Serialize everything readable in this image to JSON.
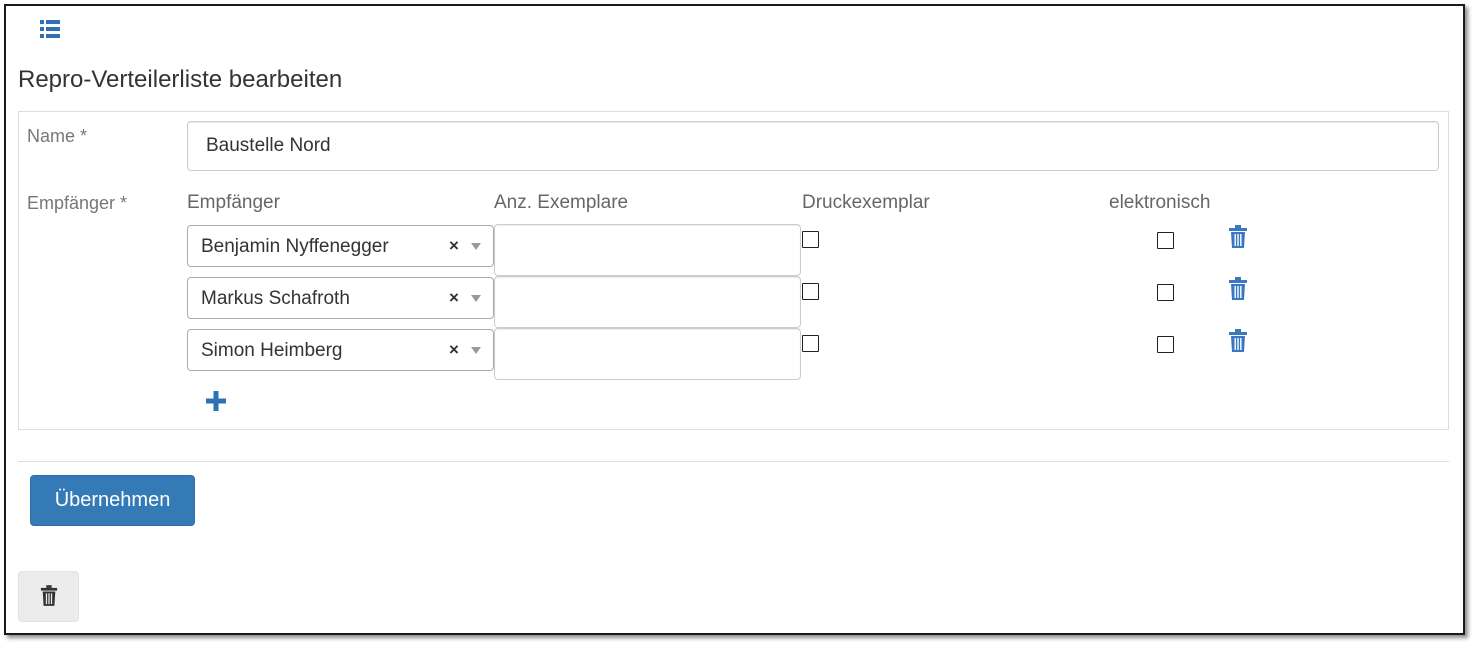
{
  "header": {
    "list_icon": "list-icon",
    "title": "Repro-Verteilerliste bearbeiten"
  },
  "form": {
    "name_label": "Name *",
    "name_value": "Baustelle Nord",
    "recipients_label": "Empfänger *",
    "columns": {
      "recipient": "Empfänger",
      "copies": "Anz. Exemplare",
      "print_copy": "Druckexemplar",
      "electronic": "elektronisch"
    },
    "clear_glyph": "×",
    "rows": [
      {
        "recipient": "Benjamin Nyffenegger",
        "copies": "",
        "print_copy": false,
        "electronic": false
      },
      {
        "recipient": "Markus Schafroth",
        "copies": "",
        "print_copy": false,
        "electronic": false
      },
      {
        "recipient": "Simon Heimberg",
        "copies": "",
        "print_copy": false,
        "electronic": false
      }
    ],
    "add_icon": "plus-icon",
    "row_delete_icon": "trash-icon"
  },
  "actions": {
    "submit_label": "Übernehmen",
    "delete_icon": "trash-icon"
  },
  "colors": {
    "accent": "#337ab7",
    "icon_blue": "#3a78c3",
    "muted_label": "#777777"
  }
}
